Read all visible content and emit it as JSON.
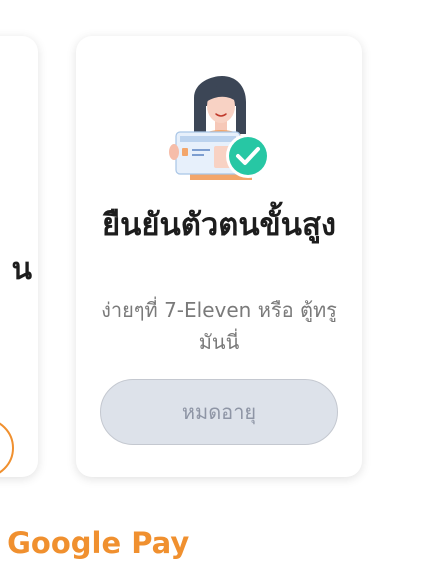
{
  "cards": {
    "left_partial": {
      "title_fragment": "น"
    },
    "main": {
      "title": "ยืนยันตัวตนขั้นสูง",
      "subtitle": "ง่ายๆที่ 7-Eleven หรือ ตู้ทรูมันนี่",
      "button_label": "หมดอายุ",
      "illustration_icon": "person-holding-id-card-with-check-icon"
    }
  },
  "bottom_link": {
    "label": "ย Google Pay"
  },
  "colors": {
    "accent_orange": "#f0902f",
    "check_green": "#27c7a4",
    "disabled_button_bg": "#dde2ea",
    "disabled_button_text": "#8e95a5"
  }
}
